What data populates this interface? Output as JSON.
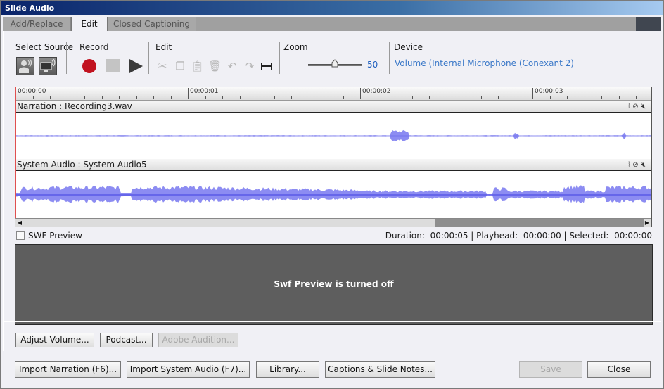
{
  "window": {
    "title": "Slide Audio"
  },
  "tabs": [
    {
      "label": "Add/Replace",
      "active": false
    },
    {
      "label": "Edit",
      "active": true
    },
    {
      "label": "Closed Captioning",
      "active": false
    }
  ],
  "toolbar": {
    "select_source": {
      "label": "Select Source",
      "icons": [
        "microphone-source-icon",
        "system-audio-source-icon"
      ]
    },
    "record": {
      "label": "Record",
      "icons": [
        "record-icon",
        "stop-icon",
        "play-icon"
      ]
    },
    "edit": {
      "label": "Edit",
      "icons": [
        "cut-icon",
        "copy-icon",
        "paste-icon",
        "delete-icon",
        "undo-icon",
        "redo-icon",
        "insert-silence-icon"
      ]
    },
    "zoom": {
      "label": "Zoom",
      "value": "50",
      "slider_fraction": 0.45
    },
    "device": {
      "label": "Device",
      "value": "Volume (Internal Microphone (Conexant 2)"
    }
  },
  "timeline": {
    "ruler_labels": [
      "00:00:00",
      "00:00:01",
      "00:00:02",
      "00:00:03"
    ],
    "tracks": [
      {
        "title": "Narration : Recording3.wav",
        "icons": [
          "split-audio-icon",
          "mute-icon"
        ]
      },
      {
        "title": "System Audio : System Audio5",
        "icons": [
          "split-audio-icon",
          "mute-icon"
        ]
      }
    ],
    "scroll_position_fraction": 0.66,
    "colors": {
      "waveform": "#7878f0",
      "waveform_center": "#5a5ae8",
      "playhead": "#e05050"
    }
  },
  "swf_preview": {
    "label": "SWF Preview",
    "checked": false,
    "message": "Swf Preview is turned off"
  },
  "status": {
    "duration_label": "Duration:",
    "duration": "00:00:05",
    "playhead_label": "Playhead:",
    "playhead": "00:00:00",
    "selected_label": "Selected:",
    "selected": "00:00:00"
  },
  "actions": {
    "adjust_volume": "Adjust Volume...",
    "podcast": "Podcast...",
    "adobe_audition": "Adobe Audition..."
  },
  "footer": {
    "import_narration": "Import Narration (F6)...",
    "import_system_audio": "Import System Audio (F7)...",
    "library": "Library...",
    "captions_notes": "Captions & Slide Notes...",
    "save": "Save",
    "close": "Close"
  }
}
